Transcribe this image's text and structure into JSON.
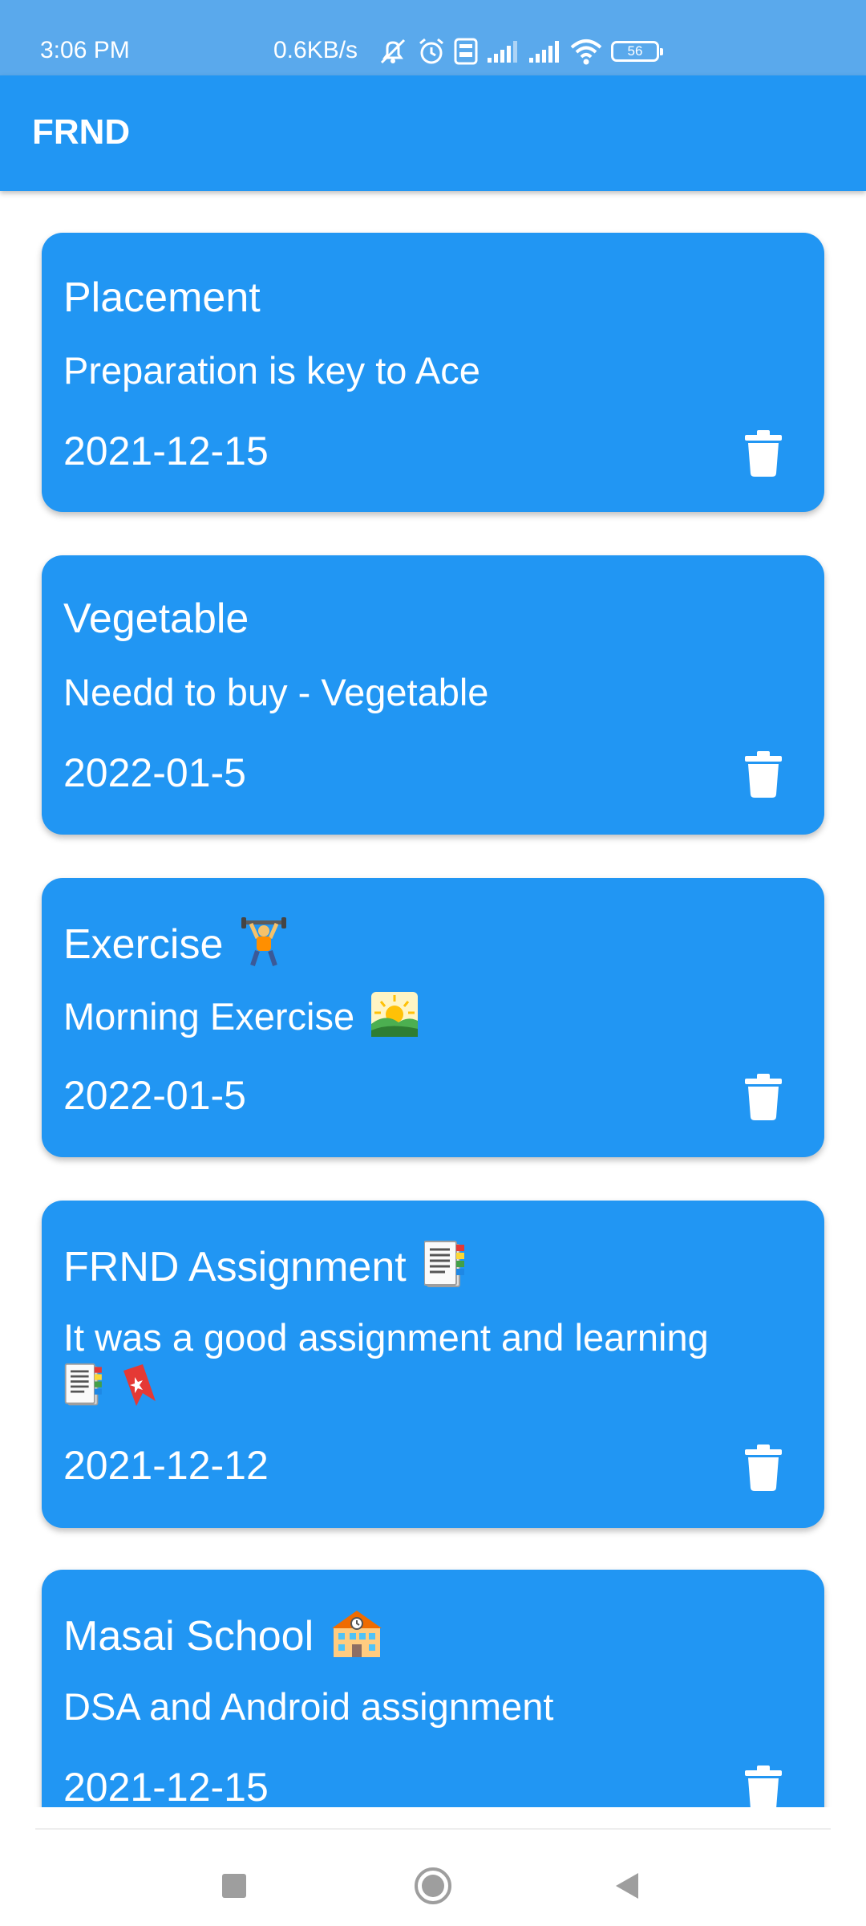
{
  "status_bar": {
    "time": "3:06 PM",
    "net_speed": "0.6KB/s",
    "battery_level": "56",
    "icons": [
      "mute-icon",
      "alarm-icon",
      "volte-icon",
      "signal-icon",
      "signal-icon",
      "wifi-icon",
      "battery-icon"
    ]
  },
  "app_bar": {
    "title": "FRND"
  },
  "colors": {
    "primary": "#2196f3",
    "status_bar": "#5aa9ec",
    "text_on_primary": "#ffffff"
  },
  "notes": [
    {
      "title": "Placement",
      "description": "Preparation is key to Ace",
      "date": "2021-12-15"
    },
    {
      "title": "Vegetable",
      "description": "Needd to buy -  Vegetable",
      "date": "2022-01-5"
    },
    {
      "title": "Exercise",
      "description": "Morning  Exercise",
      "date": "2022-01-5"
    },
    {
      "title": "FRND Assignment",
      "description": "It was a good assignment and learning",
      "date": "2021-12-12"
    },
    {
      "title": "Masai School",
      "description": "DSA and Android assignment",
      "date": "2021-12-15"
    }
  ],
  "nav_bar": {
    "icons": [
      "recents-square-icon",
      "home-circle-icon",
      "back-triangle-icon"
    ]
  }
}
